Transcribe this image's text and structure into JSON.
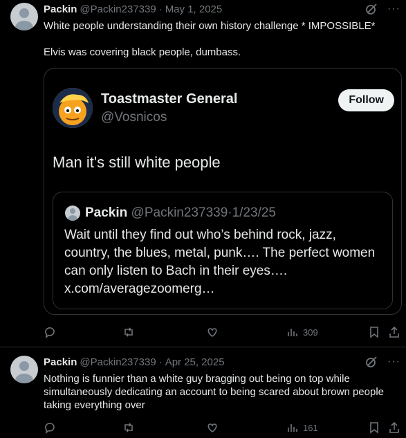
{
  "tweets": [
    {
      "name": "Packin",
      "handle": "@Packin237339",
      "dot": "·",
      "date": "May 1, 2025",
      "text": "White people understanding their own history challenge * IMPOSSIBLE*\n\nElvis was covering black people, dumbass.",
      "views": "309",
      "quoted": {
        "name": "Toastmaster General",
        "handle": "@Vosnicos",
        "follow_label": "Follow",
        "text": "Man it's still white people",
        "inner_quote": {
          "name": "Packin",
          "handle": "@Packin237339",
          "dot": "·",
          "date": "1/23/25",
          "text": "Wait until they find out who’s behind rock, jazz, country, the blues, metal, punk…. The perfect women can only listen to Bach in their eyes…. x.com/averagezoomerg…"
        }
      }
    },
    {
      "name": "Packin",
      "handle": "@Packin237339",
      "dot": "·",
      "date": "Apr 25, 2025",
      "text": "Nothing is funnier than a white guy bragging out being on top while simultaneously dedicating an account to being scared about brown people taking everything over",
      "views": "161"
    }
  ],
  "icons": {
    "more": "···"
  },
  "colors": {
    "background": "#000000",
    "text": "#e7e9ea",
    "muted": "#71767b",
    "border": "#2f3336",
    "follow_bg": "#eff3f4"
  }
}
